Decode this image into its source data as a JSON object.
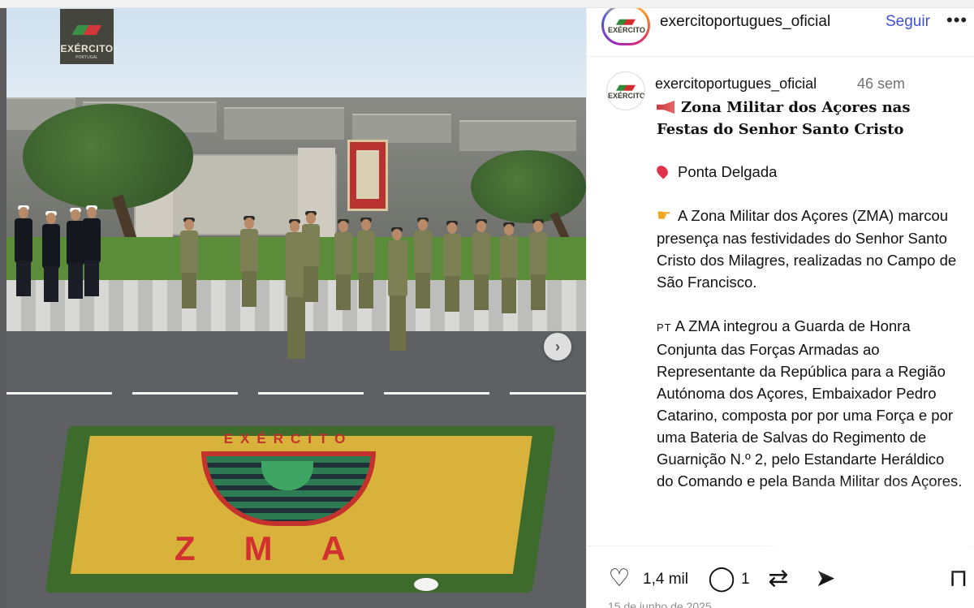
{
  "post": {
    "logo": {
      "text": "EXÉRCITO",
      "sub": "PORTUGAL"
    },
    "carpet": {
      "top_word": "EXÉRCITO",
      "bottom_word": "ZMA"
    },
    "carousel": {
      "next_icon": "chevron-right-icon"
    }
  },
  "header": {
    "username": "exercitoportugues_oficial",
    "follow_label": "Seguir",
    "more_icon": "more-horizontal-icon",
    "avatar_text": "EXÉRCITO"
  },
  "caption": {
    "username": "exercitoportugues_oficial",
    "time": "46 sem",
    "title": "Zona Militar dos Açores nas Festas do Senhor Santo Cristo",
    "location": "Ponta Delgada",
    "paragraph1": "A Zona Militar dos Açores (ZMA) marcou presença nas festividades do Senhor Santo Cristo dos Milagres, realizadas no Campo de São Francisco.",
    "pt_flag": "PT",
    "paragraph2": "A ZMA integrou a Guarda de Honra Conjunta das Forças Armadas ao Representante da República para a Região Autónoma dos Açores, Embaixador Pedro Catarino, composta por por uma Força e por uma Bateria de Salvas do Regimento de Guarnição N.º 2, pelo Estandarte Heráldico do Comando e pela Banda Militar dos Açores."
  },
  "actions": {
    "like_icon": "heart-icon",
    "likes": "1,4 mil",
    "comment_icon": "comment-icon",
    "comments": "1",
    "repost_icon": "repost-icon",
    "share_icon": "share-icon",
    "save_icon": "bookmark-icon",
    "date": "15 de junho de 2025"
  },
  "colors": {
    "follow": "#3f51d8",
    "muted": "#737373",
    "carpet_red": "#c3322d"
  }
}
